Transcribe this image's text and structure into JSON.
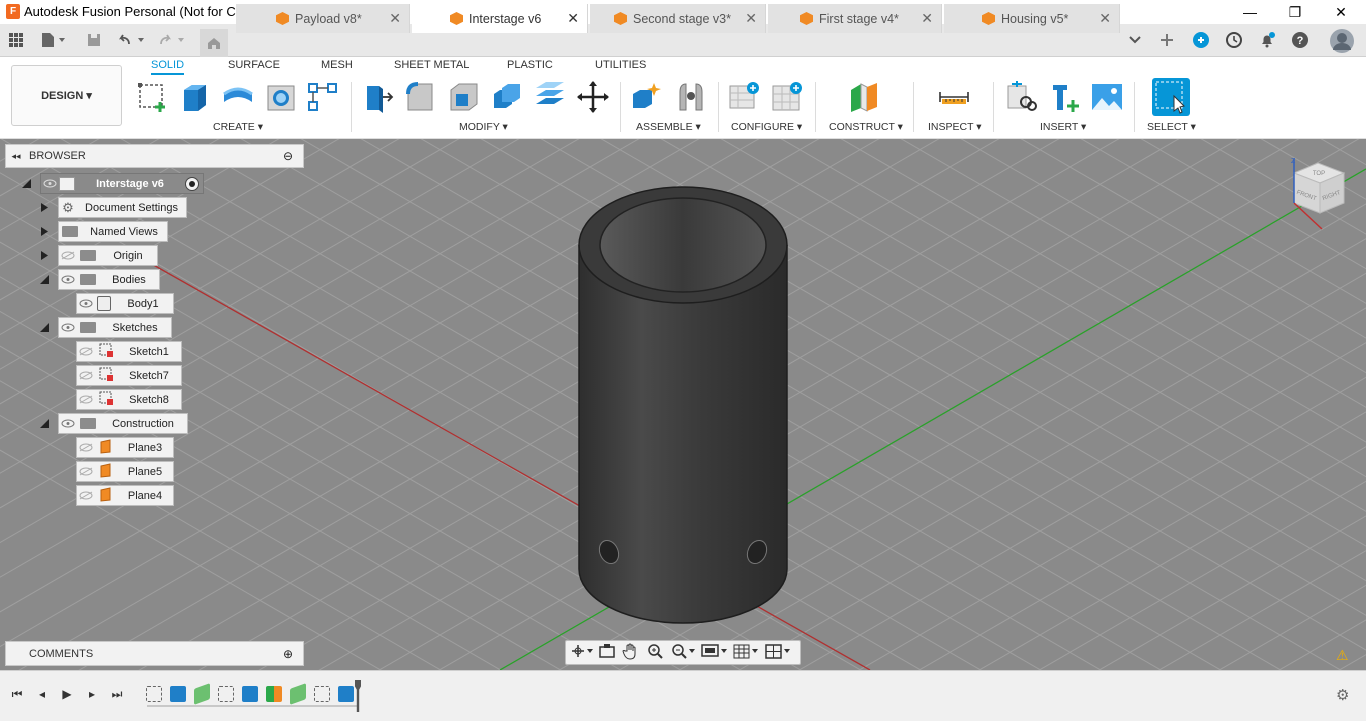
{
  "window": {
    "app_logo_letter": "F",
    "title": "Autodesk Fusion Personal (Not for Commercial Use)",
    "minimize_glyph": "—",
    "maximize_glyph": "❐",
    "close_glyph": "✕"
  },
  "tabs": [
    {
      "label": "Payload v8*",
      "active": false
    },
    {
      "label": "Interstage v6",
      "active": true
    },
    {
      "label": "Second stage v3*",
      "active": false
    },
    {
      "label": "First stage v4*",
      "active": false
    },
    {
      "label": "Housing v5*",
      "active": false
    }
  ],
  "tab_close_glyph": "✕",
  "tabbar_icons": {
    "grid": "grid-icon",
    "file": "file-icon",
    "save": "save-icon",
    "undo": "undo-icon",
    "redo": "redo-icon",
    "home": "home-icon",
    "overflow": "chevron-down-icon",
    "new_tab": "plus-icon",
    "extensions": "extensions-icon",
    "job_status": "clock-icon",
    "notifications": "bell-icon",
    "help": "help-icon",
    "profile": "avatar-icon"
  },
  "toolbar": {
    "workspace_button": "DESIGN ▾",
    "workspace_tabs": [
      "SOLID",
      "SURFACE",
      "MESH",
      "SHEET METAL",
      "PLASTIC",
      "UTILITIES"
    ],
    "active_tab": "SOLID",
    "groups": [
      "CREATE ▾",
      "MODIFY ▾",
      "ASSEMBLE ▾",
      "CONFIGURE ▾",
      "CONSTRUCT ▾",
      "INSPECT ▾",
      "INSERT ▾",
      "SELECT ▾"
    ]
  },
  "browser": {
    "title": "BROWSER",
    "collapse_glyph": "◂◂",
    "minus_glyph": "⊖",
    "root": "Interstage v6",
    "items": [
      {
        "label": "Document Settings"
      },
      {
        "label": "Named Views"
      },
      {
        "label": "Origin"
      },
      {
        "label": "Bodies"
      },
      {
        "label": "Body1"
      },
      {
        "label": "Sketches"
      },
      {
        "label": "Sketch1"
      },
      {
        "label": "Sketch7"
      },
      {
        "label": "Sketch8"
      },
      {
        "label": "Construction"
      },
      {
        "label": "Plane3"
      },
      {
        "label": "Plane5"
      },
      {
        "label": "Plane4"
      }
    ]
  },
  "comments": {
    "title": "COMMENTS",
    "add_glyph": "⊕"
  },
  "viewcube": {
    "top": "TOP",
    "front": "FRONT",
    "right": "RIGHT",
    "axis_z": "Z"
  },
  "colors": {
    "accent": "#0696d7",
    "tab_orange": "#f08a24",
    "viewport": "#8a8a8a",
    "body": "#3a3a3a"
  },
  "timeline": {
    "controls": [
      "⏮",
      "◂",
      "▶",
      "▸",
      "⏭"
    ],
    "settings_glyph": "⚙",
    "warning_glyph": "⚠"
  }
}
